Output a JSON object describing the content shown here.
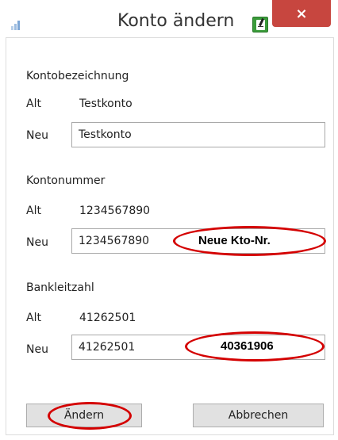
{
  "window": {
    "title": "Konto ändern",
    "close_glyph": "×",
    "close_color": "#c7463f"
  },
  "account_name": {
    "section_label": "Kontobezeichnung",
    "old_label": "Alt",
    "old_value": "Testkonto",
    "new_label": "Neu",
    "new_value": "Testkonto"
  },
  "account_number": {
    "section_label": "Kontonummer",
    "old_label": "Alt",
    "old_value": "1234567890",
    "new_label": "Neu",
    "new_value": "1234567890",
    "annotation": "Neue Kto-Nr."
  },
  "bank_code": {
    "section_label": "Bankleitzahl",
    "old_label": "Alt",
    "old_value": "41262501",
    "new_label": "Neu",
    "new_value": "41262501",
    "annotation": "40361906"
  },
  "buttons": {
    "change_label": "Ändern",
    "cancel_label": "Abbrechen"
  },
  "annotation_color": "#d40000"
}
